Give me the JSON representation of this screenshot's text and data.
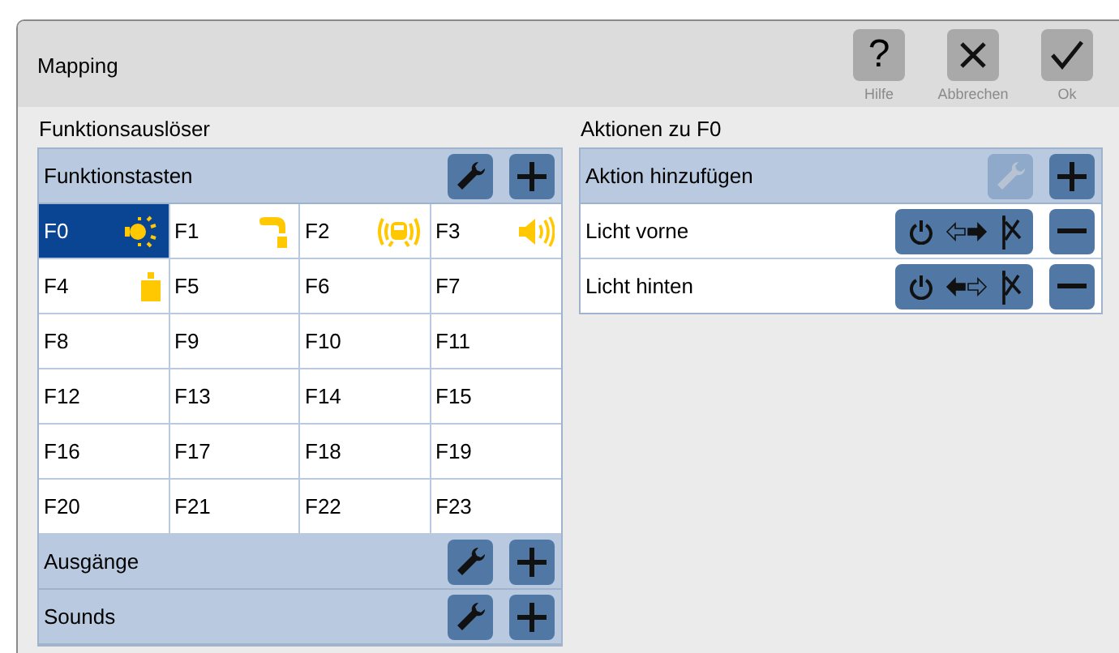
{
  "window": {
    "title": "Mapping",
    "buttons": [
      {
        "kind": "help",
        "label": "Hilfe",
        "glyph": "?"
      },
      {
        "kind": "cancel",
        "label": "Abbrechen"
      },
      {
        "kind": "ok",
        "label": "Ok"
      }
    ]
  },
  "triggers": {
    "title": "Funktionsauslöser",
    "groups": [
      {
        "label": "Funktionstasten",
        "edit_disabled": false
      },
      {
        "label": "Ausgänge",
        "edit_disabled": false
      },
      {
        "label": "Sounds",
        "edit_disabled": false
      }
    ],
    "keys": [
      {
        "label": "F0",
        "selected": true,
        "kind": "light"
      },
      {
        "label": "F1",
        "selected": false,
        "kind": "horn"
      },
      {
        "label": "F2",
        "selected": false,
        "kind": "bell"
      },
      {
        "label": "F3",
        "selected": false,
        "kind": "sound"
      },
      {
        "label": "F4",
        "selected": false,
        "kind": "weight"
      },
      {
        "label": "F5",
        "selected": false
      },
      {
        "label": "F6",
        "selected": false
      },
      {
        "label": "F7",
        "selected": false
      },
      {
        "label": "F8",
        "selected": false
      },
      {
        "label": "F9",
        "selected": false
      },
      {
        "label": "F10",
        "selected": false
      },
      {
        "label": "F11",
        "selected": false
      },
      {
        "label": "F12",
        "selected": false
      },
      {
        "label": "F13",
        "selected": false
      },
      {
        "label": "F14",
        "selected": false
      },
      {
        "label": "F15",
        "selected": false
      },
      {
        "label": "F16",
        "selected": false
      },
      {
        "label": "F17",
        "selected": false
      },
      {
        "label": "F18",
        "selected": false
      },
      {
        "label": "F19",
        "selected": false
      },
      {
        "label": "F20",
        "selected": false
      },
      {
        "label": "F21",
        "selected": false
      },
      {
        "label": "F22",
        "selected": false
      },
      {
        "label": "F23",
        "selected": false
      }
    ]
  },
  "actions": {
    "title": "Aktionen zu F0",
    "header": {
      "label": "Aktion hinzufügen",
      "edit_disabled": true
    },
    "rows": [
      {
        "label": "Licht vorne",
        "kind": "forward"
      },
      {
        "label": "Licht hinten",
        "kind": "backward"
      }
    ]
  }
}
